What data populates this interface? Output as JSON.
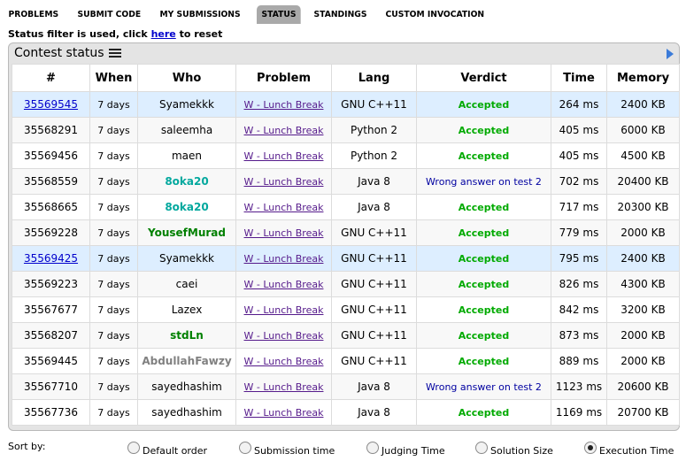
{
  "nav": {
    "tabs": [
      {
        "label": "PROBLEMS",
        "active": false
      },
      {
        "label": "SUBMIT CODE",
        "active": false
      },
      {
        "label": "MY SUBMISSIONS",
        "active": false
      },
      {
        "label": "STATUS",
        "active": true
      },
      {
        "label": "STANDINGS",
        "active": false
      },
      {
        "label": "CUSTOM INVOCATION",
        "active": false
      }
    ]
  },
  "filter": {
    "prefix": "Status filter is used, click ",
    "link": "here",
    "suffix": " to reset"
  },
  "status": {
    "title": "Contest status",
    "columns": [
      "#",
      "When",
      "Who",
      "Problem",
      "Lang",
      "Verdict",
      "Time",
      "Memory"
    ],
    "rows": [
      {
        "id": "35569545",
        "when": "7 days",
        "who": "Syamekkk",
        "who_color": "#000000",
        "problem": "W - Lunch Break",
        "lang": "GNU C++11",
        "verdict": "Accepted",
        "ok": true,
        "time": "264 ms",
        "memory": "2400 KB",
        "mine": true
      },
      {
        "id": "35568291",
        "when": "7 days",
        "who": "saleemha",
        "who_color": "#000000",
        "problem": "W - Lunch Break",
        "lang": "Python 2",
        "verdict": "Accepted",
        "ok": true,
        "time": "405 ms",
        "memory": "6000 KB",
        "mine": false
      },
      {
        "id": "35569456",
        "when": "7 days",
        "who": "maen",
        "who_color": "#000000",
        "problem": "W - Lunch Break",
        "lang": "Python 2",
        "verdict": "Accepted",
        "ok": true,
        "time": "405 ms",
        "memory": "4500 KB",
        "mine": false
      },
      {
        "id": "35568559",
        "when": "7 days",
        "who": "8oka20",
        "who_color": "#03a89e",
        "problem": "W - Lunch Break",
        "lang": "Java 8",
        "verdict": "Wrong answer on test 2",
        "ok": false,
        "time": "702 ms",
        "memory": "20400 KB",
        "mine": false
      },
      {
        "id": "35568665",
        "when": "7 days",
        "who": "8oka20",
        "who_color": "#03a89e",
        "problem": "W - Lunch Break",
        "lang": "Java 8",
        "verdict": "Accepted",
        "ok": true,
        "time": "717 ms",
        "memory": "20300 KB",
        "mine": false
      },
      {
        "id": "35569228",
        "when": "7 days",
        "who": "YousefMurad",
        "who_color": "#008000",
        "problem": "W - Lunch Break",
        "lang": "GNU C++11",
        "verdict": "Accepted",
        "ok": true,
        "time": "779 ms",
        "memory": "2000 KB",
        "mine": false
      },
      {
        "id": "35569425",
        "when": "7 days",
        "who": "Syamekkk",
        "who_color": "#000000",
        "problem": "W - Lunch Break",
        "lang": "GNU C++11",
        "verdict": "Accepted",
        "ok": true,
        "time": "795 ms",
        "memory": "2400 KB",
        "mine": true
      },
      {
        "id": "35569223",
        "when": "7 days",
        "who": "caei",
        "who_color": "#000000",
        "problem": "W - Lunch Break",
        "lang": "GNU C++11",
        "verdict": "Accepted",
        "ok": true,
        "time": "826 ms",
        "memory": "4300 KB",
        "mine": false
      },
      {
        "id": "35567677",
        "when": "7 days",
        "who": "Lazex",
        "who_color": "#000000",
        "problem": "W - Lunch Break",
        "lang": "GNU C++11",
        "verdict": "Accepted",
        "ok": true,
        "time": "842 ms",
        "memory": "3200 KB",
        "mine": false
      },
      {
        "id": "35568207",
        "when": "7 days",
        "who": "stdLn",
        "who_color": "#008000",
        "problem": "W - Lunch Break",
        "lang": "GNU C++11",
        "verdict": "Accepted",
        "ok": true,
        "time": "873 ms",
        "memory": "2000 KB",
        "mine": false
      },
      {
        "id": "35569445",
        "when": "7 days",
        "who": "AbdullahFawzy",
        "who_color": "#808080",
        "problem": "W - Lunch Break",
        "lang": "GNU C++11",
        "verdict": "Accepted",
        "ok": true,
        "time": "889 ms",
        "memory": "2000 KB",
        "mine": false
      },
      {
        "id": "35567710",
        "when": "7 days",
        "who": "sayedhashim",
        "who_color": "#000000",
        "problem": "W - Lunch Break",
        "lang": "Java 8",
        "verdict": "Wrong answer on test 2",
        "ok": false,
        "time": "1123 ms",
        "memory": "20600 KB",
        "mine": false
      },
      {
        "id": "35567736",
        "when": "7 days",
        "who": "sayedhashim",
        "who_color": "#000000",
        "problem": "W - Lunch Break",
        "lang": "Java 8",
        "verdict": "Accepted",
        "ok": true,
        "time": "1169 ms",
        "memory": "20700 KB",
        "mine": false
      }
    ]
  },
  "sort": {
    "label": "Sort by:",
    "options": [
      {
        "label": "Default order",
        "checked": false
      },
      {
        "label": "Submission time",
        "checked": false
      },
      {
        "label": "Judging Time",
        "checked": false
      },
      {
        "label": "Solution Size",
        "checked": false
      },
      {
        "label": "Execution Time",
        "checked": true
      }
    ]
  },
  "colors": {
    "accepted": "#00aa00",
    "wrong": "#0000a0",
    "active_tab": "#a9a9a9",
    "highlight_row": "#ddeeff"
  }
}
